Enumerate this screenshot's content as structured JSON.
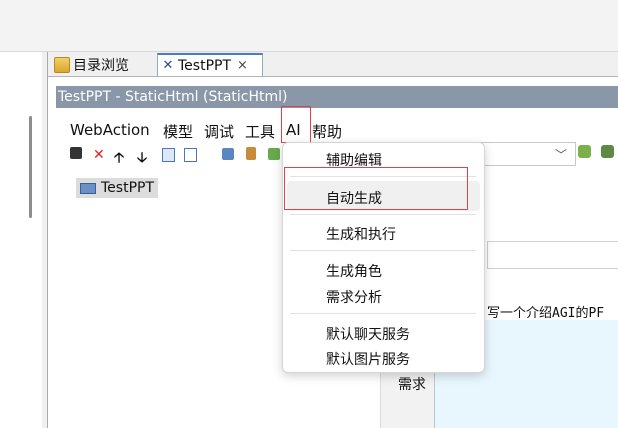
{
  "tabs": [
    {
      "label": "目录浏览",
      "icon": "folder-icon"
    },
    {
      "label": "TestPPT",
      "icon": "x-icon",
      "close": "×"
    }
  ],
  "window_title": "TestPPT - StaticHtml  (StaticHtml)",
  "menu": [
    "WebAction",
    "模型",
    "调试",
    "工具",
    "AI",
    "帮助"
  ],
  "toolbar": {
    "icons": [
      "save-icon",
      "delete-icon",
      "up-arrow-icon",
      "down-arrow-icon",
      "file-icon",
      "x-file-icon",
      "tool-icon",
      "clip-icon",
      "green-icon"
    ],
    "delete_glyph": "✕",
    "up_glyph": "🡡",
    "down_glyph": "🡣"
  },
  "tree": {
    "root": "TestPPT"
  },
  "popup_menu": {
    "items": [
      "辅助编辑",
      "自动生成",
      "生成和执行",
      "生成角色",
      "需求分析",
      "默认聊天服务",
      "默认图片服务"
    ]
  },
  "right_panel": {
    "text_snippet": "写一个介绍AGI的PF",
    "label": "需求"
  },
  "colors": {
    "highlight": "#e0414d",
    "titlebar": "#8a97a8",
    "textarea": "#e8f7fd"
  }
}
